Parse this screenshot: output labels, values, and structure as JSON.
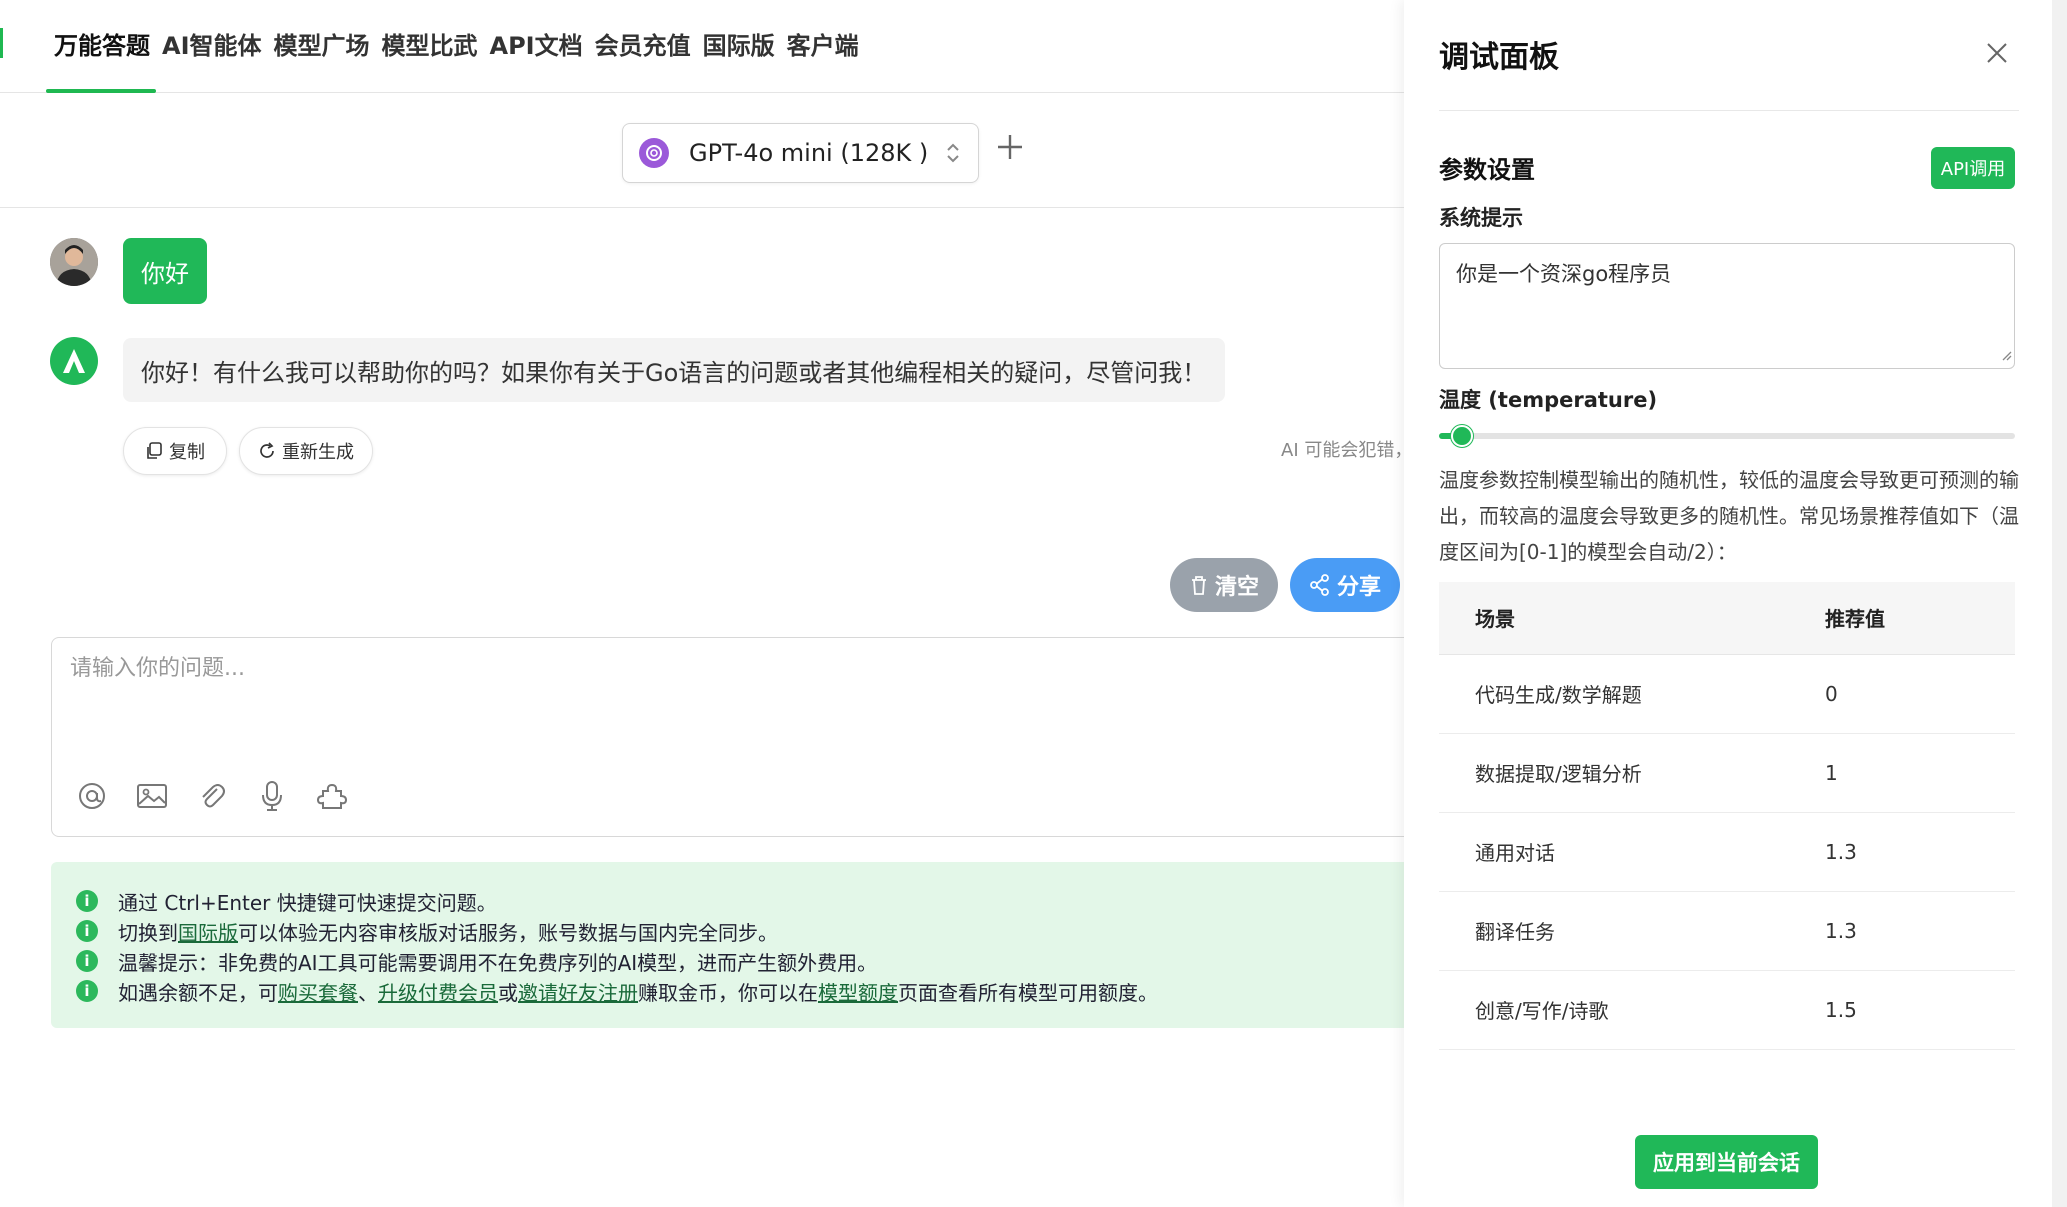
{
  "nav": {
    "tabs": [
      {
        "label": "万能答题"
      },
      {
        "label": "AI智能体"
      },
      {
        "label": "模型广场"
      },
      {
        "label": "模型比武"
      },
      {
        "label": "API文档"
      },
      {
        "label": "会员充值"
      },
      {
        "label": "国际版"
      },
      {
        "label": "客户端"
      }
    ],
    "active_tab": "万能答题"
  },
  "model_selector": {
    "value": "GPT-4o mini (128K )",
    "icon": "openai-logo-icon"
  },
  "chat": {
    "messages": [
      {
        "role": "user",
        "text": "你好",
        "avatar": "user-photo-avatar"
      },
      {
        "role": "assistant",
        "text": "你好！有什么我可以帮助你的吗？如果你有关于Go语言的问题或者其他编程相关的疑问，尽管问我！",
        "avatar": "ai-logo-avatar"
      }
    ],
    "actions": {
      "copy": "复制",
      "regenerate": "重新生成"
    },
    "warning": "AI 可能会犯错，"
  },
  "chat_controls": {
    "clear": "清空",
    "share": "分享"
  },
  "input": {
    "placeholder": "请输入你的问题...",
    "tools": [
      "at-icon",
      "image-icon",
      "paperclip-icon",
      "microphone-icon",
      "plugin-icon"
    ]
  },
  "tips": {
    "line1": "通过 Ctrl+Enter 快捷键可快速提交问题。",
    "line2_pre": "切换到 ",
    "line2_link": "国际版",
    "line2_post": " 可以体验无内容审核版对话服务，账号数据与国内完全同步。",
    "line3": "温馨提示：非免费的AI工具可能需要调用不在免费序列的AI模型，进而产生额外费用。",
    "line4_a": "如遇余额不足，可 ",
    "line4_link1": "购买套餐",
    "line4_b": "、 ",
    "line4_link2": "升级付费会员",
    "line4_c": " 或 ",
    "line4_link3": "邀请好友注册",
    "line4_d": " 赚取金币，你可以在 ",
    "line4_link4": "模型额度",
    "line4_e": " 页面查看所有模型可用额度。"
  },
  "panel": {
    "title": "调试面板",
    "section_title": "参数设置",
    "api_button": "API调用",
    "system_prompt_label": "系统提示",
    "system_prompt_value": "你是一个资深go程序员",
    "temperature_label": "温度 (temperature)",
    "temperature_fraction": 0.04,
    "temperature_desc": "温度参数控制模型输出的随机性，较低的温度会导致更可预测的输出，而较高的温度会导致更多的随机性。常见场景推荐值如下（温度区间为[0-1]的模型会自动/2）：",
    "table": {
      "headers": [
        "场景",
        "推荐值"
      ],
      "rows": [
        [
          "代码生成/数学解题",
          "0"
        ],
        [
          "数据提取/逻辑分析",
          "1"
        ],
        [
          "通用对话",
          "1.3"
        ],
        [
          "翻译任务",
          "1.3"
        ],
        [
          "创意/写作/诗歌",
          "1.5"
        ]
      ]
    },
    "apply_button": "应用到当前会话"
  },
  "colors": {
    "accent": "#20b858",
    "share": "#4a9cf5",
    "clear": "#9aa2ab",
    "tips_bg": "#e3f7e8"
  }
}
